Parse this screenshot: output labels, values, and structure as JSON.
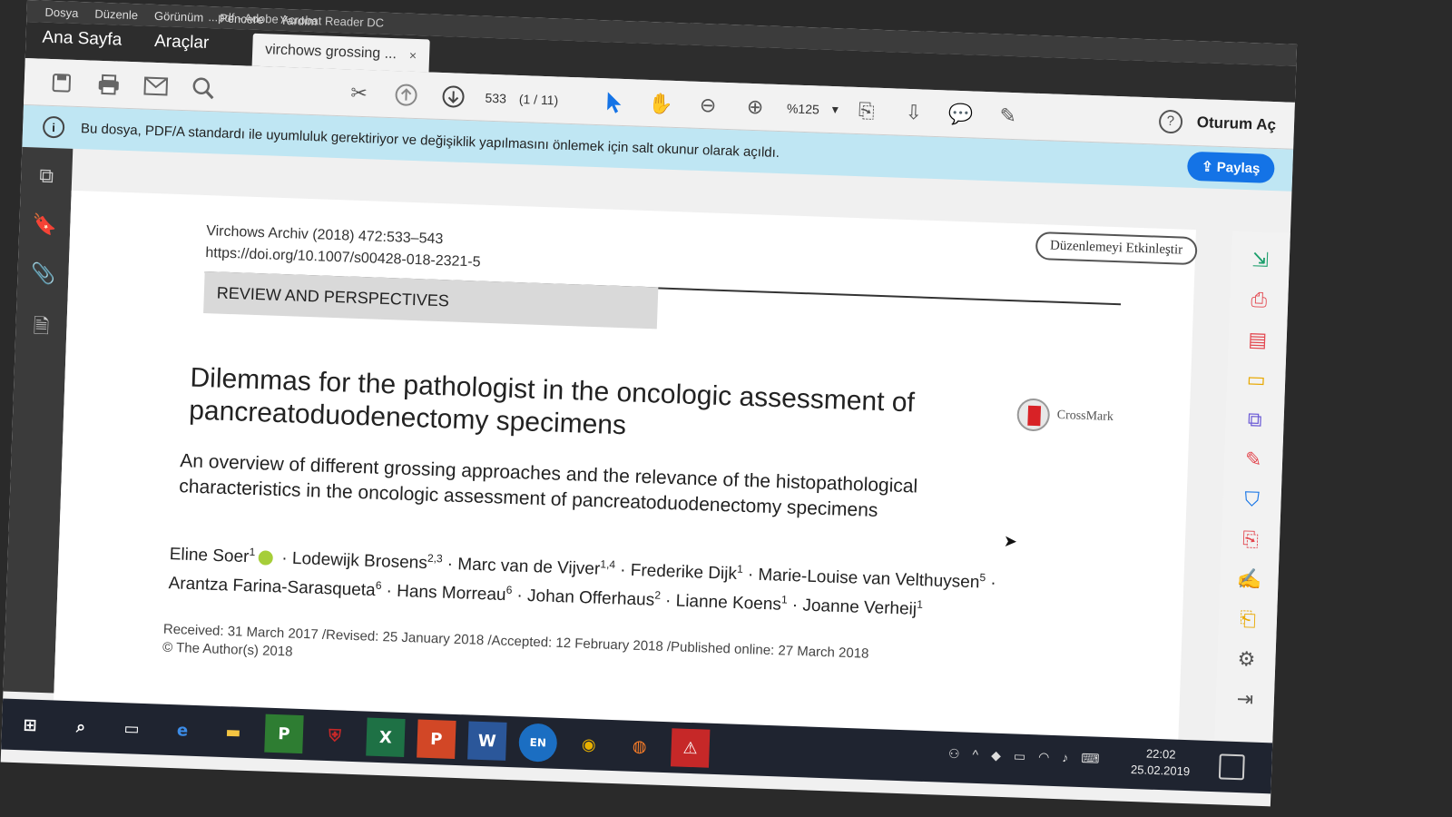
{
  "window": {
    "title": "...pdf - Adobe Acrobat Reader DC"
  },
  "menu": [
    "Dosya",
    "Düzenle",
    "Görünüm",
    "Pencere",
    "Yardım"
  ],
  "nav": {
    "home": "Ana Sayfa",
    "tools": "Araçlar",
    "doc_tab": "virchows grossing ...",
    "close": "×"
  },
  "toolbar": {
    "page_number": "533",
    "page_count": "(1 / 11)",
    "zoom": "%125",
    "signin": "Oturum Aç",
    "help": "?"
  },
  "infobar": {
    "icon": "i",
    "message": "Bu dosya, PDF/A standardı ile uyumluluk gerektiriyor ve değişiklik yapılmasını önlemek için salt okunur olarak açıldı.",
    "share": "Paylaş",
    "enable": "Düzenlemeyi Etkinleştir"
  },
  "doc": {
    "journal": "Virchows Archiv (2018) 472:533–543",
    "doi": "https://doi.org/10.1007/s00428-018-2321-5",
    "section": "REVIEW AND PERSPECTIVES",
    "crossmark": "CrossMark",
    "title": "Dilemmas for the pathologist in the oncologic assessment of pancreatoduodenectomy specimens",
    "subtitle": "An overview of different grossing approaches and the relevance of the histopathological characteristics in the oncologic assessment of pancreatoduodenectomy specimens",
    "authors": [
      {
        "name": "Eline Soer",
        "aff": "1"
      },
      {
        "name": "Lodewijk Brosens",
        "aff": "2,3"
      },
      {
        "name": "Marc van de Vijver",
        "aff": "1,4"
      },
      {
        "name": "Frederike Dijk",
        "aff": "1"
      },
      {
        "name": "Marie-Louise van Velthuysen",
        "aff": "5"
      },
      {
        "name": "Arantza Farina-Sarasqueta",
        "aff": "6"
      },
      {
        "name": "Hans Morreau",
        "aff": "6"
      },
      {
        "name": "Johan Offerhaus",
        "aff": "2"
      },
      {
        "name": "Lianne Koens",
        "aff": "1"
      },
      {
        "name": "Joanne Verheij",
        "aff": "1"
      }
    ],
    "dates": "Received: 31 March 2017 /Revised: 25 January 2018 /Accepted: 12 February 2018 /Published online: 27 March 2018",
    "copyright": "© The Author(s) 2018"
  },
  "taskbar": {
    "time": "22:02",
    "date": "25.02.2019",
    "lang": "EN"
  }
}
